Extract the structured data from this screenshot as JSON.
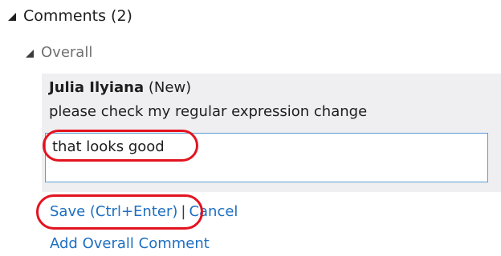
{
  "comments_section": {
    "title": "Comments (2)"
  },
  "overall_group": {
    "title": "Overall"
  },
  "comment": {
    "author": "Julia Ilyiana",
    "status": "(New)",
    "body": "please check my regular expression change"
  },
  "reply": {
    "value": "that looks good"
  },
  "actions": {
    "save_label": "Save (Ctrl+Enter)",
    "separator": "|",
    "cancel_label": "Cancel"
  },
  "add_overall_comment_label": "Add Overall Comment",
  "colors": {
    "link": "#1e6fc1",
    "highlight_circle": "#e3131f",
    "panel_bg": "#efeff2",
    "input_border": "#5a9bd5",
    "muted_text": "#717171"
  },
  "icons": {
    "expanded": "expanded-triangle-icon"
  }
}
